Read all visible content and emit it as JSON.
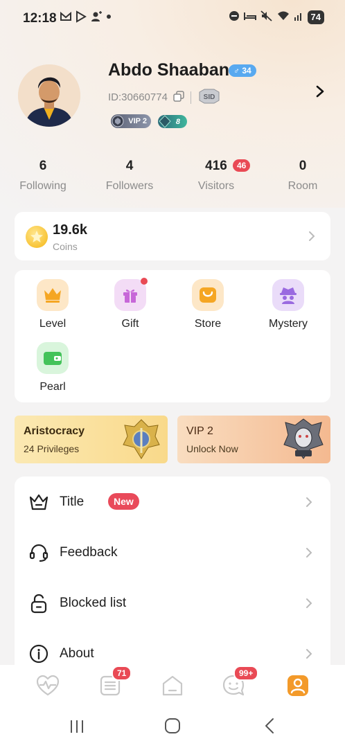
{
  "status_bar": {
    "time": "12:18",
    "left_icons": [
      "gmail-icon",
      "play-store-icon",
      "person-add-icon",
      "dot-icon"
    ],
    "right_icons": [
      "do-not-disturb-icon",
      "sleep-icon",
      "mute-icon",
      "wifi-icon",
      "signal-icon"
    ],
    "battery": "74"
  },
  "profile": {
    "name": "Abdo Shaaban",
    "gender_age": "♂ 34",
    "user_id": "ID:30660774",
    "sid_badge": "SID",
    "vip_chip": "VIP 2",
    "level_chip": "8"
  },
  "stats": [
    {
      "value": "6",
      "label": "Following"
    },
    {
      "value": "4",
      "label": "Followers"
    },
    {
      "value": "416",
      "label": "Visitors",
      "badge": "46"
    },
    {
      "value": "0",
      "label": "Room"
    }
  ],
  "coins": {
    "value": "19.6k",
    "label": "Coins"
  },
  "menu_tiles": [
    {
      "label": "Level",
      "icon": "crown-icon"
    },
    {
      "label": "Gift",
      "icon": "gift-icon"
    },
    {
      "label": "Store",
      "icon": "bag-icon"
    },
    {
      "label": "Mystery",
      "icon": "spy-icon"
    },
    {
      "label": "Pearl",
      "icon": "wallet-icon"
    }
  ],
  "promos": {
    "aristocracy": {
      "title": "Aristocracy",
      "subtitle": "24 Privileges"
    },
    "vip": {
      "title": "VIP 2",
      "subtitle": "Unlock Now"
    }
  },
  "list": [
    {
      "label": "Title",
      "icon": "crown-outline-icon",
      "badge": "New"
    },
    {
      "label": "Feedback",
      "icon": "headset-icon"
    },
    {
      "label": "Blocked list",
      "icon": "lock-icon"
    },
    {
      "label": "About",
      "icon": "info-icon"
    }
  ],
  "bottom_nav": {
    "items": [
      "heartbeat-icon",
      "list-icon",
      "home-icon",
      "chat-icon",
      "profile-icon"
    ],
    "list_badge": "71",
    "chat_badge": "99+"
  },
  "colors": {
    "accent": "#f39a2a",
    "badge_red": "#e94a55",
    "gender_blue": "#58a9f0"
  }
}
